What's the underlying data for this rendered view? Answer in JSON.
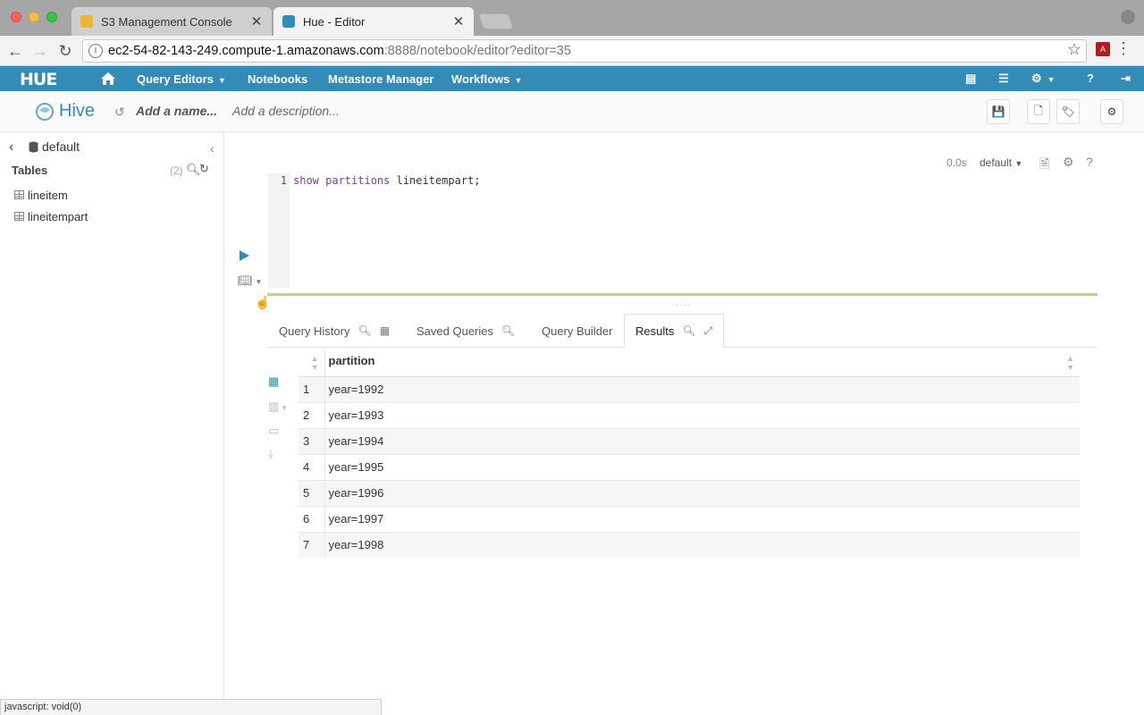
{
  "browser": {
    "tabs": [
      {
        "title": "S3 Management Console"
      },
      {
        "title": "Hue - Editor"
      }
    ],
    "url_host": "ec2-54-82-143-249.compute-1.amazonaws.com",
    "url_rest": ":8888/notebook/editor?editor=35",
    "status_text": "javascript: void(0)"
  },
  "hue_nav": {
    "logo": "HUE",
    "items": [
      "Query Editors",
      "Notebooks",
      "Metastore Manager",
      "Workflows"
    ]
  },
  "editor": {
    "title": "Hive",
    "name_placeholder": "Add a name...",
    "description_placeholder": "Add a description...",
    "line_number": "1",
    "code_keyword": "show partitions",
    "code_rest": " lineitempart;",
    "exec_time": "0.0s",
    "database": "default"
  },
  "left_panel": {
    "database": "default",
    "tables_label": "Tables",
    "tables_count": "(2)",
    "tables": [
      "lineitem",
      "lineitempart"
    ]
  },
  "result_tabs": [
    "Query History",
    "Saved Queries",
    "Query Builder",
    "Results"
  ],
  "results": {
    "column": "partition",
    "rows": [
      {
        "n": "1",
        "v": "year=1992"
      },
      {
        "n": "2",
        "v": "year=1993"
      },
      {
        "n": "3",
        "v": "year=1994"
      },
      {
        "n": "4",
        "v": "year=1995"
      },
      {
        "n": "5",
        "v": "year=1996"
      },
      {
        "n": "6",
        "v": "year=1997"
      },
      {
        "n": "7",
        "v": "year=1998"
      }
    ]
  },
  "colors": {
    "hue_blue": "#338bb8",
    "editor_accent": "#b9d57c"
  }
}
